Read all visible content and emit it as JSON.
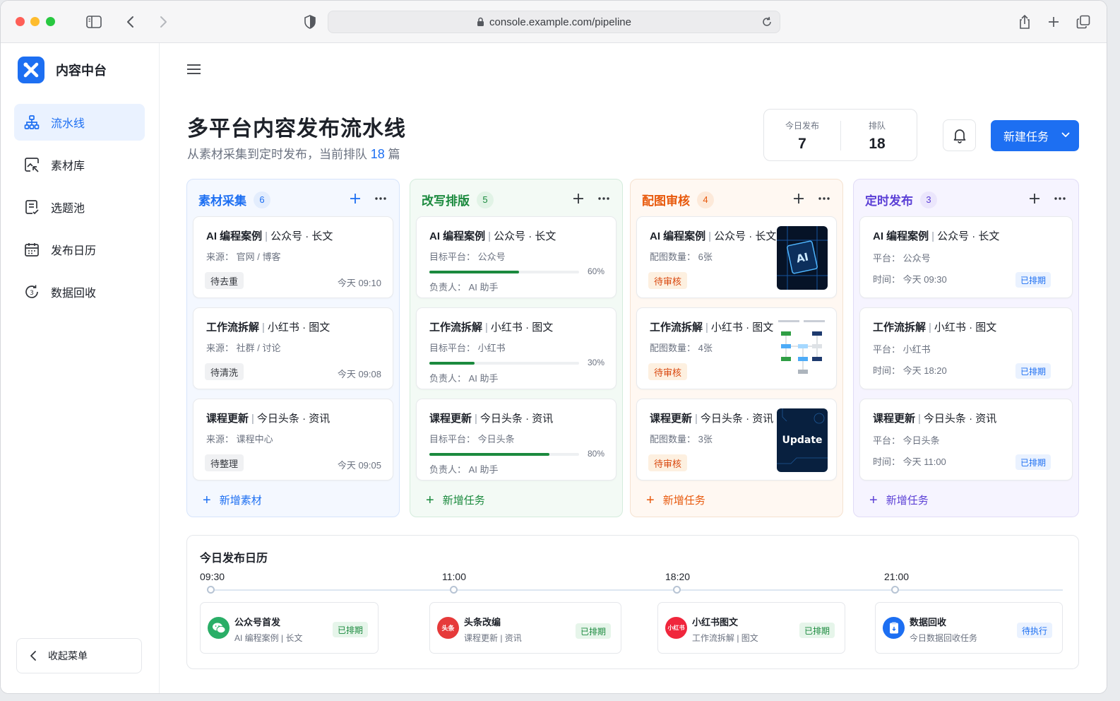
{
  "browser": {
    "url": "console.example.com/pipeline"
  },
  "app": {
    "name": "内容中台"
  },
  "sidebar": {
    "items": [
      {
        "label": "流水线",
        "icon": "sitemap-icon"
      },
      {
        "label": "素材库",
        "icon": "image-folder-icon"
      },
      {
        "label": "选题池",
        "icon": "list-doc-icon"
      },
      {
        "label": "发布日历",
        "icon": "calendar-icon"
      },
      {
        "label": "数据回收",
        "icon": "recycle-icon"
      }
    ],
    "collapse_label": "收起菜单"
  },
  "header": {
    "title": "多平台内容发布流水线",
    "subtitle_prefix": "从素材采集到定时发布，当前排队",
    "subtitle_count": "18",
    "subtitle_suffix": "篇",
    "stats": [
      {
        "label": "今日发布",
        "value": "7"
      },
      {
        "label": "排队",
        "value": "18"
      }
    ],
    "new_button": "新建任务"
  },
  "columns": [
    {
      "title": "素材采集",
      "count": "6",
      "color": "#1d6ff2",
      "add_label": "新增素材",
      "cards": [
        {
          "title": "AI 编程案例",
          "meta": "公众号 · 长文",
          "line1": "来源： 官网 / 博客",
          "tag": "待去重",
          "time": "今天 09:10"
        },
        {
          "title": "工作流拆解",
          "meta": "小红书 · 图文",
          "line1": "来源： 社群 / 讨论",
          "tag": "待清洗",
          "time": "今天 09:08"
        },
        {
          "title": "课程更新",
          "meta": "今日头条 · 资讯",
          "line1": "来源： 课程中心",
          "tag": "待整理",
          "time": "今天 09:05"
        }
      ]
    },
    {
      "title": "改写排版",
      "count": "5",
      "color": "#1b8a3e",
      "add_label": "新增任务",
      "cards": [
        {
          "title": "AI 编程案例",
          "meta": "公众号 · 长文",
          "line1": "目标平台： 公众号",
          "progress": 60,
          "progress_label": "60%",
          "line2": "负责人： AI 助手"
        },
        {
          "title": "工作流拆解",
          "meta": "小红书 · 图文",
          "line1": "目标平台： 小红书",
          "progress": 30,
          "progress_label": "30%",
          "line2": "负责人： AI 助手"
        },
        {
          "title": "课程更新",
          "meta": "今日头条 · 资讯",
          "line1": "目标平台： 今日头条",
          "progress": 80,
          "progress_label": "80%",
          "line2": "负责人： AI 助手"
        }
      ]
    },
    {
      "title": "配图审核",
      "count": "4",
      "color": "#e8590c",
      "add_label": "新增任务",
      "cards": [
        {
          "title": "AI 编程案例",
          "meta": "公众号 · 长文",
          "line1": "配图数量： 6张",
          "tag": "待审核",
          "thumb_text": "AI"
        },
        {
          "title": "工作流拆解",
          "meta": "小红书 · 图文",
          "line1": "配图数量： 4张",
          "tag": "待审核",
          "thumb_text": ""
        },
        {
          "title": "课程更新",
          "meta": "今日头条 · 资讯",
          "line1": "配图数量： 3张",
          "tag": "待审核",
          "thumb_text": "Update"
        }
      ]
    },
    {
      "title": "定时发布",
      "count": "3",
      "color": "#5b3fd6",
      "add_label": "新增任务",
      "cards": [
        {
          "title": "AI 编程案例",
          "meta": "公众号 · 长文",
          "line1": "平台： 公众号",
          "line2": "时间： 今天 09:30",
          "tag": "已排期"
        },
        {
          "title": "工作流拆解",
          "meta": "小红书 · 图文",
          "line1": "平台： 小红书",
          "line2": "时间： 今天 18:20",
          "tag": "已排期"
        },
        {
          "title": "课程更新",
          "meta": "今日头条 · 资讯",
          "line1": "平台： 今日头条",
          "line2": "时间： 今天 11:00",
          "tag": "已排期"
        }
      ]
    }
  ],
  "calendar": {
    "title": "今日发布日历",
    "events": [
      {
        "time": "09:30",
        "name": "公众号首发",
        "sub": "AI 编程案例 | 长文",
        "status": "已排期",
        "icon": "wechat-icon",
        "icon_text": ""
      },
      {
        "time": "11:00",
        "name": "头条改编",
        "sub": "课程更新 | 资讯",
        "status": "已排期",
        "icon": "toutiao-icon",
        "icon_text": "头条"
      },
      {
        "time": "18:20",
        "name": "小红书图文",
        "sub": "工作流拆解 | 图文",
        "status": "已排期",
        "icon": "xiaohongshu-icon",
        "icon_text": "小红书"
      },
      {
        "time": "21:00",
        "name": "数据回收",
        "sub": "今日数据回收任务",
        "status": "待执行",
        "icon": "data-recycle-icon",
        "icon_text": ""
      }
    ]
  }
}
